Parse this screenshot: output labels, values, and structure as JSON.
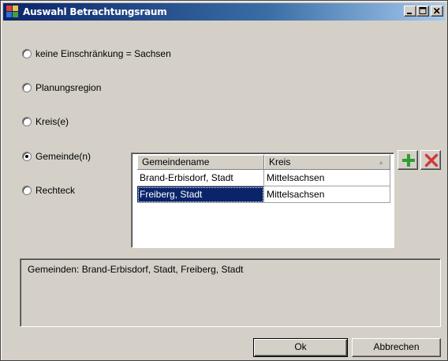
{
  "window": {
    "title": "Auswahl Betrachtungsraum",
    "icon": "app-grid-icon",
    "controls": [
      "minimize-icon",
      "maximize-icon",
      "close-icon"
    ]
  },
  "options": [
    {
      "label": "keine Einschränkung = Sachsen",
      "selected": false
    },
    {
      "label": "Planungsregion",
      "selected": false
    },
    {
      "label": "Kreis(e)",
      "selected": false
    },
    {
      "label": "Gemeinde(n)",
      "selected": true
    },
    {
      "label": "Rechteck",
      "selected": false
    }
  ],
  "grid": {
    "columns": [
      "Gemeindename",
      "Kreis"
    ],
    "sort_indicator": "▲",
    "rows": [
      {
        "name": "Brand-Erbisdorf, Stadt",
        "kreis": "Mittelsachsen",
        "selected": false
      },
      {
        "name": "Freiberg, Stadt",
        "kreis": "Mittelsachsen",
        "selected": true
      }
    ]
  },
  "tools": {
    "add_icon": "plus-icon",
    "remove_icon": "delete-x-icon",
    "add_color": "#2e9e2e",
    "remove_color": "#d03a3a"
  },
  "summary": {
    "text": "Gemeinden: Brand-Erbisdorf, Stadt, Freiberg, Stadt"
  },
  "buttons": {
    "ok": "Ok",
    "cancel": "Abbrechen"
  },
  "colors": {
    "titlebar_start": "#0a246a",
    "titlebar_end": "#a6caf0",
    "face": "#d4d0c8",
    "selection": "#0a246a"
  }
}
